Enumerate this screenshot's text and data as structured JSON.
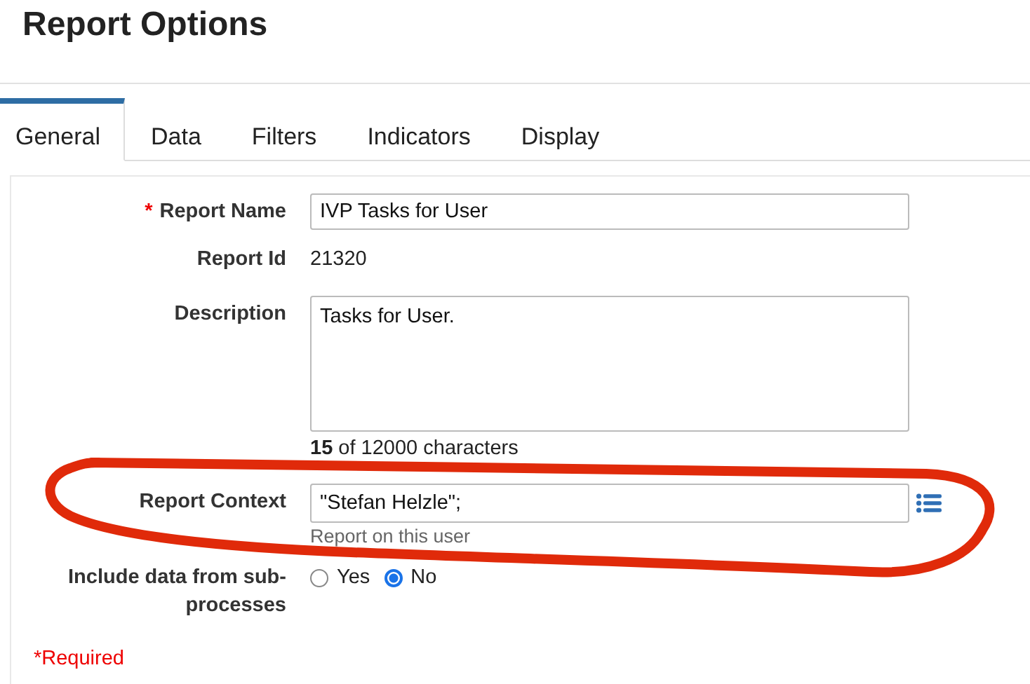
{
  "title": "Report Options",
  "tabs": [
    {
      "label": "General",
      "selected": true
    },
    {
      "label": "Data",
      "selected": false
    },
    {
      "label": "Filters",
      "selected": false
    },
    {
      "label": "Indicators",
      "selected": false
    },
    {
      "label": "Display",
      "selected": false
    }
  ],
  "fields": [
    {
      "kind": "input",
      "required_mark": "*",
      "label": "Report Name",
      "value": "IVP Tasks for User"
    },
    {
      "kind": "text",
      "label": "Report Id",
      "value": "21320"
    },
    {
      "kind": "textarea",
      "label": "Description",
      "value": "Tasks for User.",
      "counter": "**15** of 12000 characters"
    },
    {
      "kind": "picker",
      "label": "Report Context",
      "value": "\"Stefan Helzle\";",
      "hint": "Report on this user"
    },
    {
      "kind": "radio",
      "label": "Include data from sub-processes",
      "options": [
        {
          "label": "Yes",
          "selected": false
        },
        {
          "label": "No",
          "selected": true
        }
      ]
    }
  ],
  "required_note": "*Required"
}
